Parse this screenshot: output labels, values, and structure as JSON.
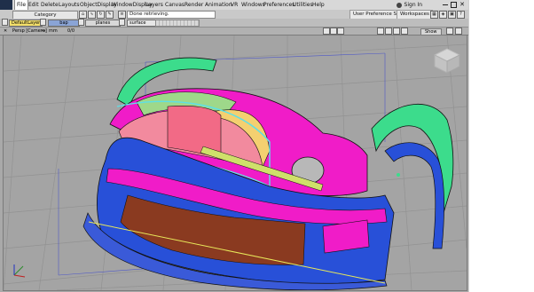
{
  "app": {
    "logo_text": "screen"
  },
  "menu": {
    "items": [
      "File",
      "Edit",
      "Delete",
      "Layouts",
      "ObjectDisplay",
      "WindowDisplay",
      "Layers",
      "Canvas",
      "Render",
      "Animation",
      "VR",
      "Windows",
      "Preferences",
      "Utilities",
      "Help"
    ],
    "active": "File",
    "sign_in": "Sign In"
  },
  "toolbar": {
    "category_label": "Category",
    "status_text": "Done retrieving.",
    "tabs": [
      "User Preference Sets",
      "Workspaces"
    ]
  },
  "layers": {
    "items": [
      {
        "label": "DefaultLayer",
        "color": "#f4e06a"
      },
      {
        "label": "bap",
        "color": "#8aa4d6"
      },
      {
        "label": "planes",
        "color": "#d8d8d8"
      },
      {
        "label": "surface",
        "color": "#e6e6e6"
      }
    ]
  },
  "viewport": {
    "title": "Persp [Camera]",
    "units": "mm",
    "extra": "0/0",
    "show_label": "Show"
  },
  "colors": {
    "background": "#a4a4a4",
    "grid": "#8e8e8e",
    "blue": "#2850d8",
    "magenta": "#f01cc8",
    "green": "#3cdc8c",
    "brown": "#8a3a20"
  }
}
